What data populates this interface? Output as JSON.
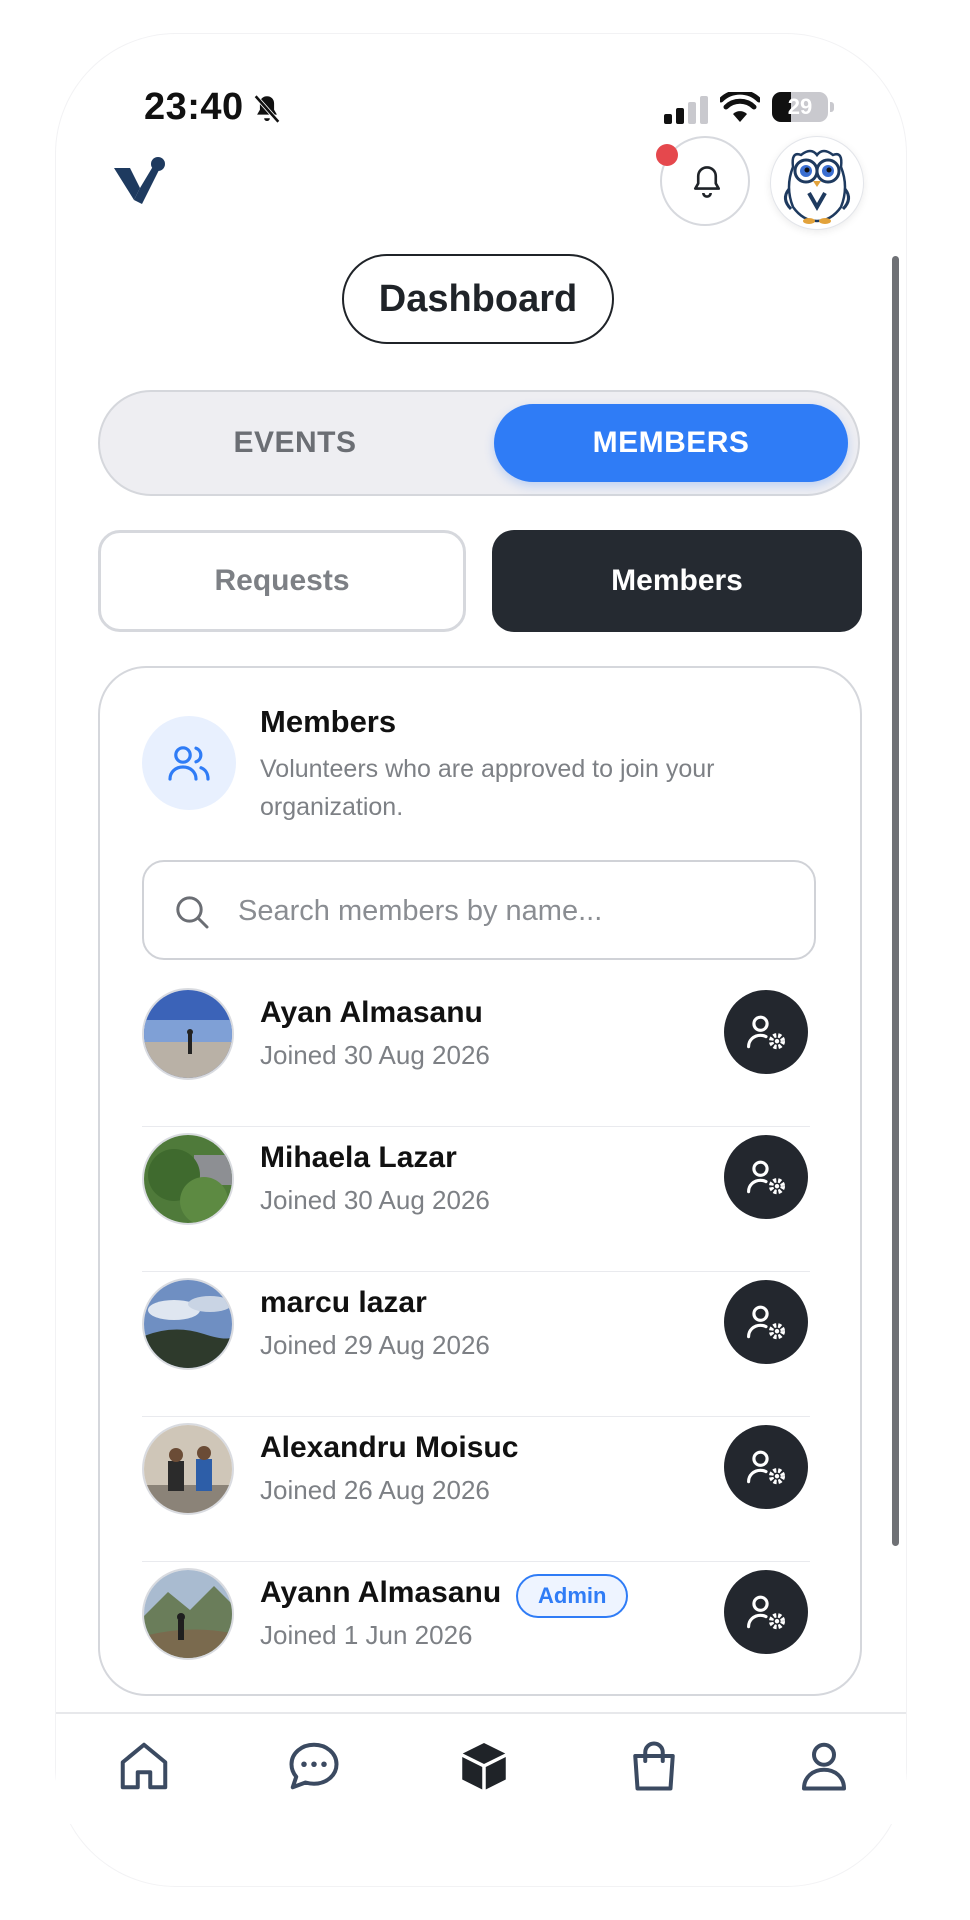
{
  "status_bar": {
    "time": "23:40",
    "battery": "29"
  },
  "header": {
    "title": "Dashboard"
  },
  "segmented": {
    "events": "EVENTS",
    "members": "MEMBERS",
    "selected": "MEMBERS"
  },
  "subtabs": {
    "requests": "Requests",
    "members": "Members",
    "selected": "Members"
  },
  "card": {
    "title": "Members",
    "description": "Volunteers who are approved to join your organization.",
    "search_placeholder": "Search members by name..."
  },
  "members": [
    {
      "name": "Ayan Almasanu",
      "joined": "Joined 30 Aug 2026"
    },
    {
      "name": "Mihaela Lazar",
      "joined": "Joined 30 Aug 2026"
    },
    {
      "name": "marcu lazar",
      "joined": "Joined 29 Aug 2026"
    },
    {
      "name": "Alexandru Moisuc",
      "joined": "Joined 26 Aug 2026"
    },
    {
      "name": "Ayann Almasanu",
      "joined": "Joined 1 Jun 2026",
      "badge": "Admin"
    }
  ],
  "bottom_nav": {
    "items": [
      "home-icon",
      "chat-icon",
      "box-icon",
      "shopping-bag-icon",
      "profile-icon"
    ],
    "active": "box-icon"
  },
  "colors": {
    "accent": "#2f7cf6",
    "dark": "#252a31",
    "notification": "#e5484d"
  }
}
